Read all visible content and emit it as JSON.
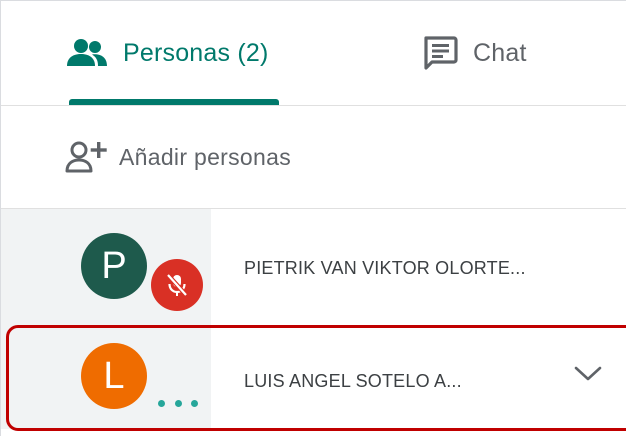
{
  "tabs": {
    "people": {
      "label": "Personas (2)",
      "icon": "people-icon",
      "active": true
    },
    "chat": {
      "label": "Chat",
      "icon": "chat-icon",
      "active": false
    }
  },
  "add_people": {
    "label": "Añadir personas",
    "icon": "add-person-icon"
  },
  "participants": [
    {
      "initial": "P",
      "name": "PIETRIK VAN VIKTOR OLORTE...",
      "avatar_color": "#1e5a4c",
      "status": "muted",
      "status_icon": "mic-off-icon"
    },
    {
      "initial": "L",
      "name": "LUIS ANGEL SOTELO A...",
      "avatar_color": "#ef6c00",
      "status": "speaking",
      "status_icon": "more-dots-icon",
      "expand_icon": "chevron-down-icon"
    }
  ],
  "colors": {
    "accent": "#00796b",
    "muted": "#d93025",
    "highlight": "#c00000"
  }
}
